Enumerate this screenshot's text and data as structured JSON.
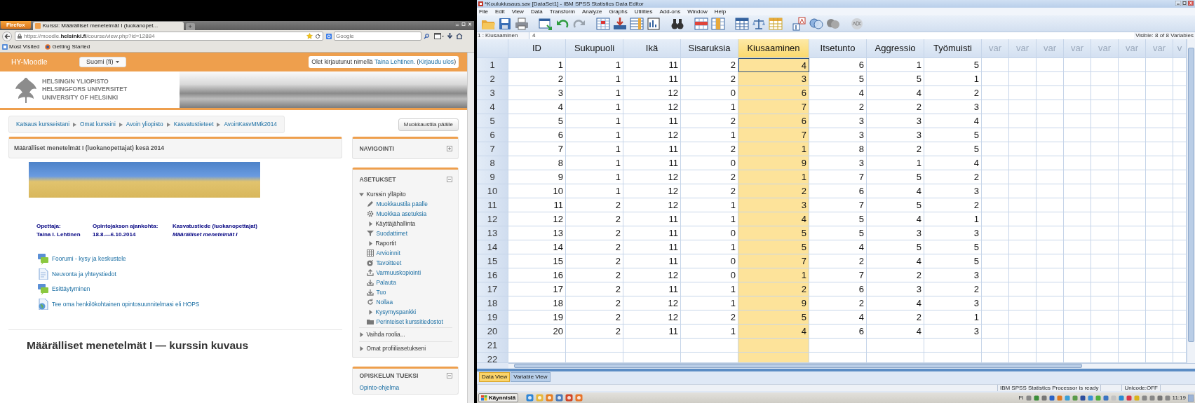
{
  "browser": {
    "menu_button": "Firefox",
    "tabs": [
      {
        "title": "Kurssi: Määrälliset menetelmät I (luokanopet...",
        "selected": true
      }
    ],
    "new_tab": "+",
    "url": "https://moodle.**helsinki.fi**/course/view.php?id=12884",
    "search": {
      "placeholder": "Google"
    },
    "bookmarks": [
      "Most Visited",
      "Getting Started"
    ]
  },
  "moodle": {
    "site_name": "HY-Moodle",
    "language": "Suomi (fi)",
    "login": {
      "before": "Olet kirjautunut nimellä",
      "user": "Taina Lehtinen.",
      "open": "(",
      "logout": "Kirjaudu ulos",
      "close": ")"
    },
    "university_name": [
      "HELSINGIN YLIOPISTO",
      "HELSINGFORS UNIVERSITET",
      "UNIVERSITY OF HELSINKI"
    ],
    "breadcrumb": [
      "Katsaus kursseistani",
      "Omat kurssini",
      "Avoin yliopisto",
      "Kasvatustieteet",
      "AvoinKasvMMk2014"
    ],
    "edit_button": "Muokkaustila päälle",
    "course_title": "Määrälliset menetelmät I (luokanopettajat) kesä 2014",
    "info_columns": [
      {
        "heading": "Opettaja:",
        "value": "Taina I. Lehtinen",
        "italic": false
      },
      {
        "heading": "Opintojakson ajankohta:",
        "value": "18.8.—6.10.2014",
        "italic": false
      },
      {
        "heading": "Kasvatustiede (luokanopettajat)",
        "value": "Määrälliset menetelmät I",
        "italic": true
      }
    ],
    "activities": [
      {
        "kind": "forum",
        "label": "Foorumi - kysy ja keskustele"
      },
      {
        "kind": "page",
        "label": "Neuvonta ja yhteystiedot"
      },
      {
        "kind": "forum",
        "label": "Esittäytyminen"
      },
      {
        "kind": "url",
        "label": "Tee oma henkilökohtainen opintosuunnitelmasi eli HOPS"
      }
    ],
    "section_heading": "Määrälliset menetelmät I — kurssin kuvaus",
    "blocks": [
      {
        "title": "NAVIGOINTI",
        "expanded": false
      },
      {
        "title": "ASETUKSET",
        "expanded": true,
        "items": [
          {
            "kind": "branch",
            "label": "Kurssin ylläpito",
            "expanded": true,
            "linked": false,
            "children": [
              {
                "kind": "link",
                "label": "Muokkaustila päälle"
              },
              {
                "kind": "link",
                "label": "Muokkaa asetuksia"
              },
              {
                "kind": "branch",
                "label": "Käyttäjähallinta",
                "expanded": false,
                "linked": false
              },
              {
                "kind": "link",
                "label": "Suodattimet"
              },
              {
                "kind": "branch",
                "label": "Raportit",
                "expanded": false,
                "linked": false
              },
              {
                "kind": "link",
                "label": "Arvioinnit"
              },
              {
                "kind": "link",
                "label": "Tavoitteet"
              },
              {
                "kind": "link",
                "label": "Varmuuskopiointi"
              },
              {
                "kind": "link",
                "label": "Palauta"
              },
              {
                "kind": "link",
                "label": "Tuo"
              },
              {
                "kind": "link",
                "label": "Nollaa"
              },
              {
                "kind": "branch",
                "label": "Kysymyspankki",
                "expanded": false,
                "linked": true
              },
              {
                "kind": "link",
                "label": "Perinteiset kurssitiedostot"
              }
            ]
          },
          {
            "kind": "branch",
            "label": "Vaihda roolia...",
            "expanded": false,
            "linked": false
          },
          {
            "kind": "branch",
            "label": "Omat profiiliasetukseni",
            "expanded": false,
            "linked": false
          }
        ]
      },
      {
        "title": "OPISKELUN TUEKSI",
        "expanded": true,
        "items": [
          {
            "kind": "link",
            "label": "Opinto-ohjelma"
          }
        ]
      }
    ]
  },
  "spss": {
    "title": "*Koulukiusaus.sav [DataSet1] - IBM SPSS Statistics Data Editor",
    "menus": [
      "File",
      "Edit",
      "View",
      "Data",
      "Transform",
      "Analyze",
      "Graphs",
      "Utilities",
      "Add-ons",
      "Window",
      "Help"
    ],
    "cell_reference": "1 : Kiusaaminen",
    "cell_value": "4",
    "visible_info": "Visible: 8 of 8 Variables",
    "columns": [
      {
        "name": "ID",
        "kind": "variable",
        "selected": false
      },
      {
        "name": "Sukupuoli",
        "kind": "variable",
        "selected": false
      },
      {
        "name": "Ikä",
        "kind": "variable",
        "selected": false
      },
      {
        "name": "Sisaruksia",
        "kind": "variable",
        "selected": false
      },
      {
        "name": "Kiusaaminen",
        "kind": "variable",
        "selected": true
      },
      {
        "name": "Itsetunto",
        "kind": "variable",
        "selected": false
      },
      {
        "name": "Aggressio",
        "kind": "variable",
        "selected": false
      },
      {
        "name": "Työmuisti",
        "kind": "variable",
        "selected": false
      },
      {
        "name": "var",
        "kind": "empty",
        "selected": false
      },
      {
        "name": "var",
        "kind": "empty",
        "selected": false
      },
      {
        "name": "var",
        "kind": "empty",
        "selected": false
      },
      {
        "name": "var",
        "kind": "empty",
        "selected": false
      },
      {
        "name": "var",
        "kind": "empty",
        "selected": false
      },
      {
        "name": "var",
        "kind": "empty",
        "selected": false
      },
      {
        "name": "var",
        "kind": "empty",
        "selected": false
      },
      {
        "name": "v",
        "kind": "empty",
        "selected": false
      }
    ],
    "rows": [
      {
        "number": "1",
        "active": true,
        "cells": [
          "1",
          "1",
          "11",
          "2",
          "4",
          "6",
          "1",
          "5"
        ]
      },
      {
        "number": "2",
        "active": false,
        "cells": [
          "2",
          "1",
          "11",
          "2",
          "3",
          "5",
          "5",
          "1"
        ]
      },
      {
        "number": "3",
        "active": false,
        "cells": [
          "3",
          "1",
          "12",
          "0",
          "6",
          "4",
          "4",
          "2"
        ]
      },
      {
        "number": "4",
        "active": false,
        "cells": [
          "4",
          "1",
          "12",
          "1",
          "7",
          "2",
          "2",
          "3"
        ]
      },
      {
        "number": "5",
        "active": false,
        "cells": [
          "5",
          "1",
          "11",
          "2",
          "6",
          "3",
          "3",
          "4"
        ]
      },
      {
        "number": "6",
        "active": false,
        "cells": [
          "6",
          "1",
          "12",
          "1",
          "7",
          "3",
          "3",
          "5"
        ]
      },
      {
        "number": "7",
        "active": false,
        "cells": [
          "7",
          "1",
          "11",
          "2",
          "1",
          "8",
          "2",
          "5"
        ]
      },
      {
        "number": "8",
        "active": false,
        "cells": [
          "8",
          "1",
          "11",
          "0",
          "9",
          "3",
          "1",
          "4"
        ]
      },
      {
        "number": "9",
        "active": false,
        "cells": [
          "9",
          "1",
          "12",
          "2",
          "1",
          "7",
          "5",
          "2"
        ]
      },
      {
        "number": "10",
        "active": false,
        "cells": [
          "10",
          "1",
          "12",
          "2",
          "2",
          "6",
          "4",
          "3"
        ]
      },
      {
        "number": "11",
        "active": false,
        "cells": [
          "11",
          "2",
          "12",
          "1",
          "3",
          "7",
          "5",
          "2"
        ]
      },
      {
        "number": "12",
        "active": false,
        "cells": [
          "12",
          "2",
          "11",
          "1",
          "4",
          "5",
          "4",
          "1"
        ]
      },
      {
        "number": "13",
        "active": false,
        "cells": [
          "13",
          "2",
          "11",
          "0",
          "5",
          "5",
          "3",
          "3"
        ]
      },
      {
        "number": "14",
        "active": false,
        "cells": [
          "14",
          "2",
          "11",
          "1",
          "5",
          "4",
          "5",
          "5"
        ]
      },
      {
        "number": "15",
        "active": false,
        "cells": [
          "15",
          "2",
          "11",
          "0",
          "7",
          "2",
          "4",
          "5"
        ]
      },
      {
        "number": "16",
        "active": false,
        "cells": [
          "16",
          "2",
          "12",
          "0",
          "1",
          "7",
          "2",
          "3"
        ]
      },
      {
        "number": "17",
        "active": false,
        "cells": [
          "17",
          "2",
          "11",
          "1",
          "2",
          "6",
          "3",
          "2"
        ]
      },
      {
        "number": "18",
        "active": false,
        "cells": [
          "18",
          "2",
          "12",
          "1",
          "9",
          "2",
          "4",
          "3"
        ]
      },
      {
        "number": "19",
        "active": false,
        "cells": [
          "19",
          "2",
          "12",
          "2",
          "5",
          "4",
          "2",
          "1"
        ]
      },
      {
        "number": "20",
        "active": false,
        "cells": [
          "20",
          "2",
          "11",
          "1",
          "4",
          "6",
          "4",
          "3"
        ]
      },
      {
        "number": "21",
        "active": false
      },
      {
        "number": "22",
        "active": false
      }
    ],
    "view_tabs": [
      {
        "label": "Data View",
        "selected": true
      },
      {
        "label": "Variable View",
        "selected": false
      }
    ],
    "status": {
      "message": "IBM SPSS Statistics Processor is ready",
      "encoding": "Unicode:OFF"
    }
  },
  "taskbar": {
    "start": "Käynnistä",
    "language": "FI",
    "clock": "11:19"
  }
}
